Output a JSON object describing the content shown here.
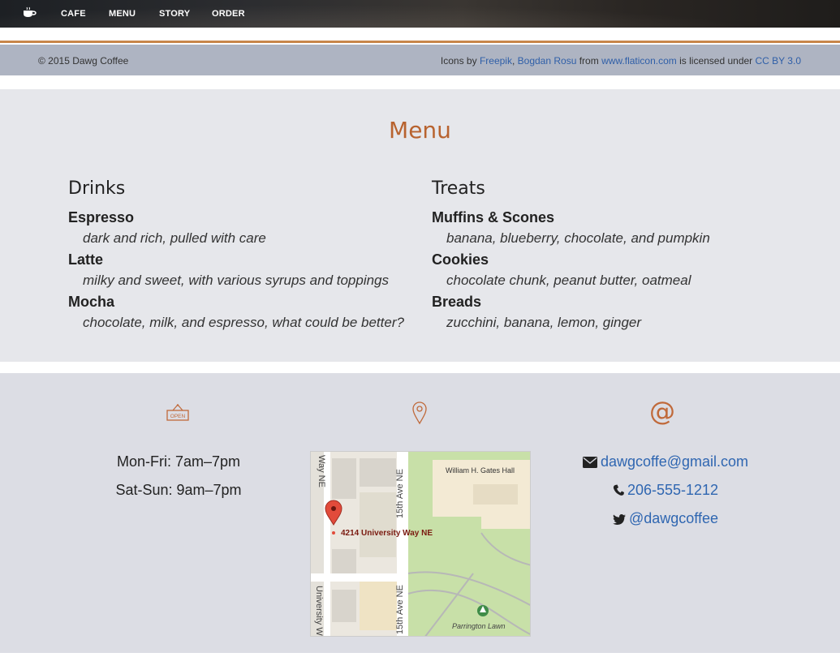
{
  "nav": {
    "links": [
      "CAFE",
      "MENU",
      "STORY",
      "ORDER"
    ]
  },
  "footer": {
    "copyright": "© 2015 Dawg Coffee",
    "credits_prefix": "Icons by",
    "credit_author_1": "Freepik",
    "credit_sep": ",",
    "credit_author_2": "Bogdan Rosu",
    "credit_from": "from",
    "credit_site": "www.flaticon.com",
    "credit_license_text": "is licensed under",
    "credit_license": "CC BY 3.0"
  },
  "menu": {
    "title": "Menu",
    "drinks": {
      "heading": "Drinks",
      "items": [
        {
          "name": "Espresso",
          "desc": "dark and rich, pulled with care"
        },
        {
          "name": "Latte",
          "desc": "milky and sweet, with various syrups and toppings"
        },
        {
          "name": "Mocha",
          "desc": "chocolate, milk, and espresso, what could be better?"
        }
      ]
    },
    "treats": {
      "heading": "Treats",
      "items": [
        {
          "name": "Muffins & Scones",
          "desc": "banana, blueberry, chocolate, and pumpkin"
        },
        {
          "name": "Cookies",
          "desc": "chocolate chunk, peanut butter, oatmeal"
        },
        {
          "name": "Breads",
          "desc": "zucchini, banana, lemon, ginger"
        }
      ]
    }
  },
  "info": {
    "open_sign": "OPEN",
    "hours": [
      "Mon-Fri: 7am–7pm",
      "Sat-Sun: 9am–7pm"
    ],
    "map": {
      "pin_label": "4214 University Way NE",
      "street_1": "Way NE",
      "street_2": "15th Ave NE",
      "street_3": "University W",
      "street_4": "15th Ave NE",
      "building": "William H. Gates Hall",
      "park": "Parrington Lawn"
    },
    "at_symbol": "@",
    "email": "dawgcoffe@gmail.com",
    "phone": "206-555-1212",
    "twitter": "@dawgcoffee"
  },
  "colors": {
    "accent": "#b8632f",
    "link": "#2f66b1"
  }
}
